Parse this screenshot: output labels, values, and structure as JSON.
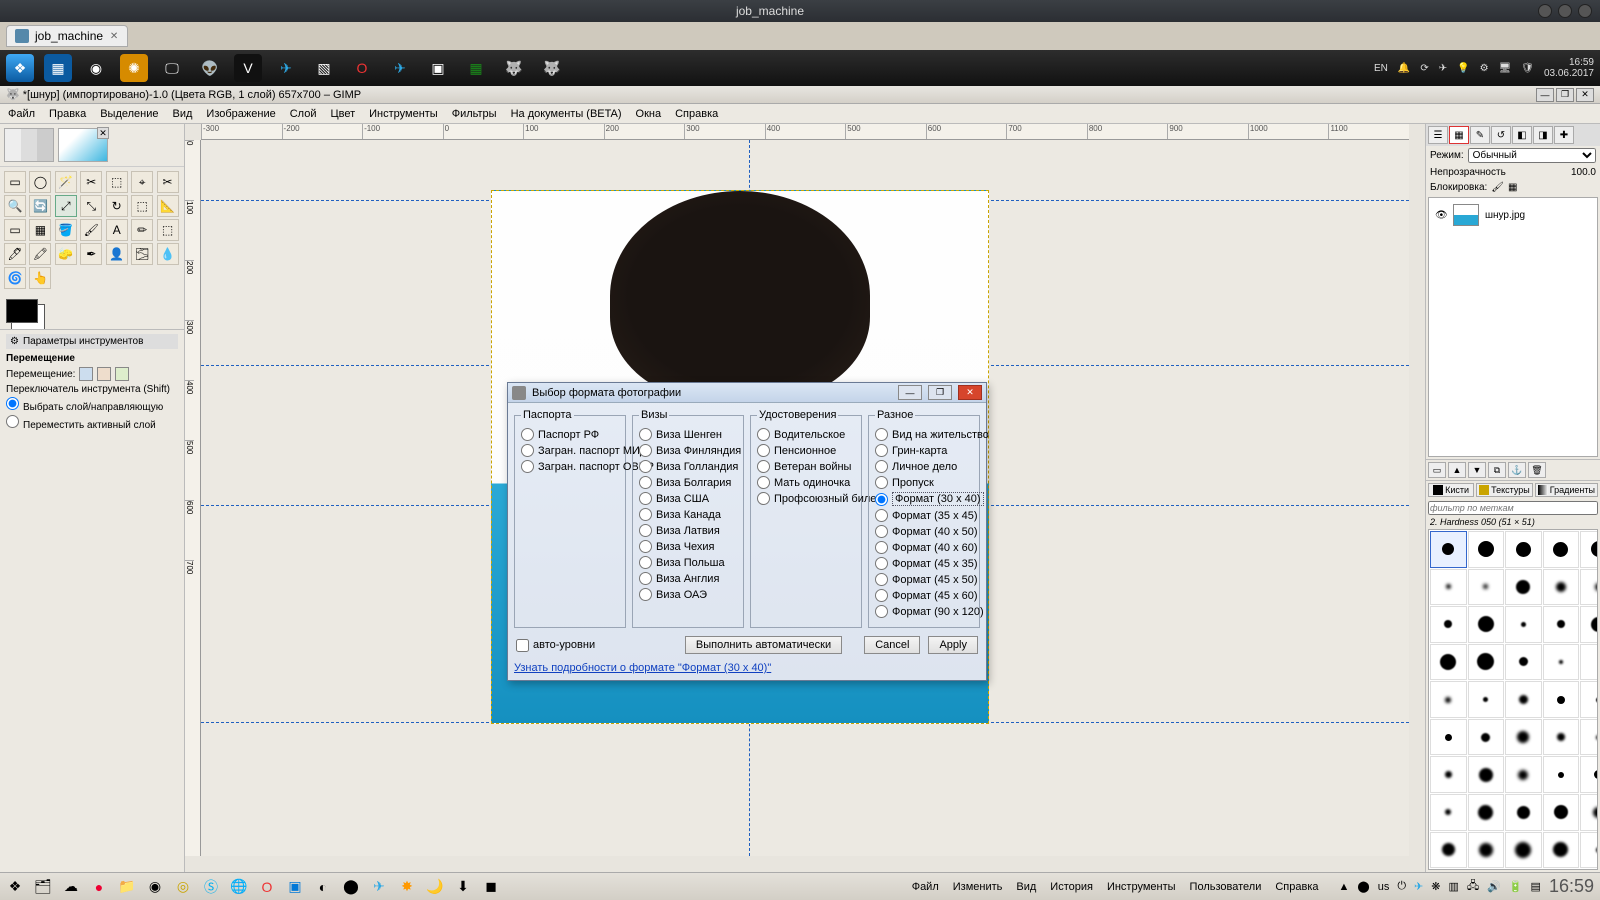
{
  "window": {
    "title": "job_machine"
  },
  "browser_tab": {
    "label": "job_machine"
  },
  "top_taskbar": {
    "lang": "EN",
    "time": "16:59",
    "date": "03.06.2017"
  },
  "gimp": {
    "title": "*[шнур] (импортировано)-1.0 (Цвета RGB, 1 слой) 657x700 – GIMP",
    "menu": [
      "Файл",
      "Правка",
      "Выделение",
      "Вид",
      "Изображение",
      "Слой",
      "Цвет",
      "Инструменты",
      "Фильтры",
      "На документы (BETA)",
      "Окна",
      "Справка"
    ],
    "ruler_h": [
      "-300",
      "-200",
      "-100",
      "0",
      "100",
      "200",
      "300",
      "400",
      "500",
      "600",
      "700",
      "800",
      "900",
      "1000",
      "1100"
    ],
    "tool_options": {
      "header": "Параметры инструментов",
      "section": "Перемещение",
      "move_label": "Перемещение:",
      "switch_label": "Переключатель инструмента  (Shift)",
      "opt1": "Выбрать слой/направляющую",
      "opt2": "Переместить активный слой"
    }
  },
  "rightdock": {
    "mode_label": "Режим:",
    "mode_value": "Обычный",
    "opacity_label": "Непрозрачность",
    "opacity_value": "100.0",
    "lock_label": "Блокировка:",
    "layer_name": "шнур.jpg",
    "brush_tabs": [
      "Кисти",
      "Текстуры",
      "Градиенты"
    ],
    "brush_filter_placeholder": "фильтр по меткам",
    "brush_selected": "2. Hardness 050 (51 × 51)"
  },
  "dialog": {
    "title": "Выбор формата фотографии",
    "groups": {
      "passports": {
        "legend": "Паспорта",
        "items": [
          "Паспорт РФ",
          "Загран. паспорт МИД",
          "Загран. паспорт ОВИР"
        ]
      },
      "visas": {
        "legend": "Визы",
        "items": [
          "Виза Шенген",
          "Виза Финляндия",
          "Виза Голландия",
          "Виза Болгария",
          "Виза США",
          "Виза Канада",
          "Виза Латвия",
          "Виза Чехия",
          "Виза Польша",
          "Виза Англия",
          "Виза ОАЭ"
        ]
      },
      "ids": {
        "legend": "Удостоверения",
        "items": [
          "Водительское",
          "Пенсионное",
          "Ветеран войны",
          "Мать одиночка",
          "Профсоюзный билет"
        ]
      },
      "misc": {
        "legend": "Разное",
        "items": [
          "Вид на жительство",
          "Грин-карта",
          "Личное дело",
          "Пропуск",
          "Формат (30 x 40)",
          "Формат (35 x 45)",
          "Формат (40 x 50)",
          "Формат (40 x 60)",
          "Формат (45 x 35)",
          "Формат (45 x 50)",
          "Формат (45 x 60)",
          "Формат (90 x 120)"
        ],
        "selected_index": 4
      }
    },
    "auto_levels": "авто-уровни",
    "btn_auto": "Выполнить автоматически",
    "btn_cancel": "Cancel",
    "btn_apply": "Apply",
    "link": "Узнать подробности о формате \"Формат (30 x 40)\""
  },
  "bottom_taskbar": {
    "menu": [
      "Файл",
      "Изменить",
      "Вид",
      "История",
      "Инструменты",
      "Пользователи",
      "Справка"
    ],
    "lang": "us",
    "clock": "16:59"
  }
}
